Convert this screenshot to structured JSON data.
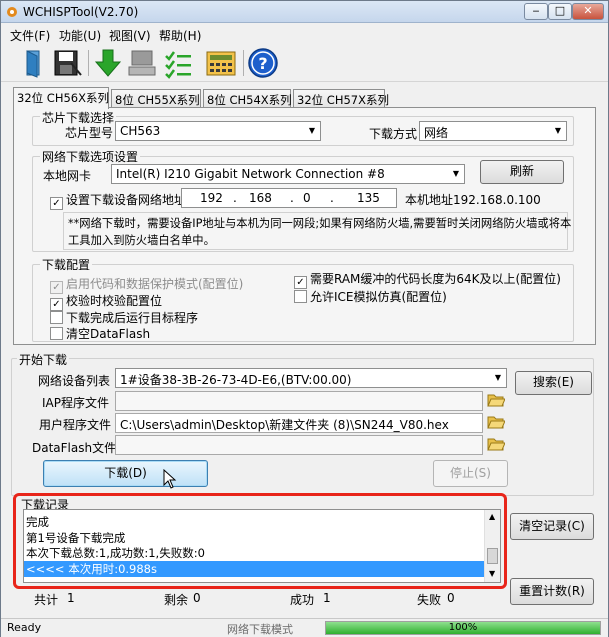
{
  "window": {
    "title": "WCHISPTool(V2.70)",
    "min": "‒",
    "max": "□",
    "close": "✕"
  },
  "menu": [
    "文件(F)",
    "功能(U)",
    "视图(V)",
    "帮助(H)"
  ],
  "toolbar": {
    "icons": [
      "open-file-icon",
      "save-file-icon",
      "download-icon",
      "device-icon",
      "verify-icon",
      "calculator-icon",
      "help-icon"
    ],
    "help_glyph": "?"
  },
  "tabs": [
    "32位 CH56X系列",
    "8位 CH55X系列",
    "8位 CH54X系列",
    "32位 CH57X系列"
  ],
  "chip": {
    "group_title": "芯片下载选择",
    "model_label": "芯片型号",
    "model_value": "CH563",
    "mode_label": "下载方式",
    "mode_value": "网络"
  },
  "network": {
    "group_title": "网络下载选项设置",
    "nic_label": "本地网卡",
    "nic_value": "Intel(R) I210 Gigabit Network Connection #8",
    "refresh_label": "刷新",
    "set_ip_label": "设置下载设备网络地址",
    "ip": [
      "192",
      "168",
      "0",
      "135"
    ],
    "ip_dot": ".",
    "local_addr_label": "本机地址192.168.0.100",
    "note_line1": "**网络下载时，需要设备IP地址与本机为同一网段;如果有网络防火墙,需要暂时关闭网络防火墙或将本",
    "note_line2": "工具加入到防火墙白名单中。"
  },
  "config": {
    "group_title": "下载配置",
    "opt_protect": "启用代码和数据保护模式(配置位)",
    "opt_verify": "校验时校验配置位",
    "opt_run": "下载完成后运行目标程序",
    "opt_clear_df": "清空DataFlash",
    "opt_ram": "需要RAM缓冲的代码长度为64K及以上(配置位)",
    "opt_ice": "允许ICE模拟仿真(配置位)",
    "check_mark": "✓"
  },
  "download": {
    "group_title": "开始下载",
    "device_list_label": "网络设备列表",
    "device_list_value": "1#设备38-3B-26-73-4D-E6,(BTV:00.00)",
    "search_label": "搜索(E)",
    "iap_label": "IAP程序文件",
    "iap_value": "",
    "user_label": "用户程序文件",
    "user_value": "C:\\Users\\admin\\Desktop\\新建文件夹 (8)\\SN244_V80.hex",
    "dataflash_label": "DataFlash文件",
    "dataflash_value": "",
    "download_btn": "下载(D)",
    "stop_btn": "停止(S)"
  },
  "log": {
    "group_title": "下载记录",
    "lines": [
      "完成",
      "第1号设备下载完成",
      "本次下载总数:1,成功数:1,失败数:0",
      "<<<< 本次用时:0.988s"
    ],
    "clear_btn": "清空记录(C)"
  },
  "stats": {
    "total_label": "共计",
    "total_value": "1",
    "remain_label": "剩余",
    "remain_value": "0",
    "success_label": "成功",
    "success_value": "1",
    "fail_label": "失败",
    "fail_value": "0",
    "reset_btn": "重置计数(R)"
  },
  "status": {
    "ready": "Ready",
    "mode": "网络下载模式",
    "progress_text": "100%",
    "progress_value": 1.0
  },
  "colors": {
    "highlight": "#e8251a",
    "selection": "#3399ff",
    "progress": "#2fb02f"
  }
}
